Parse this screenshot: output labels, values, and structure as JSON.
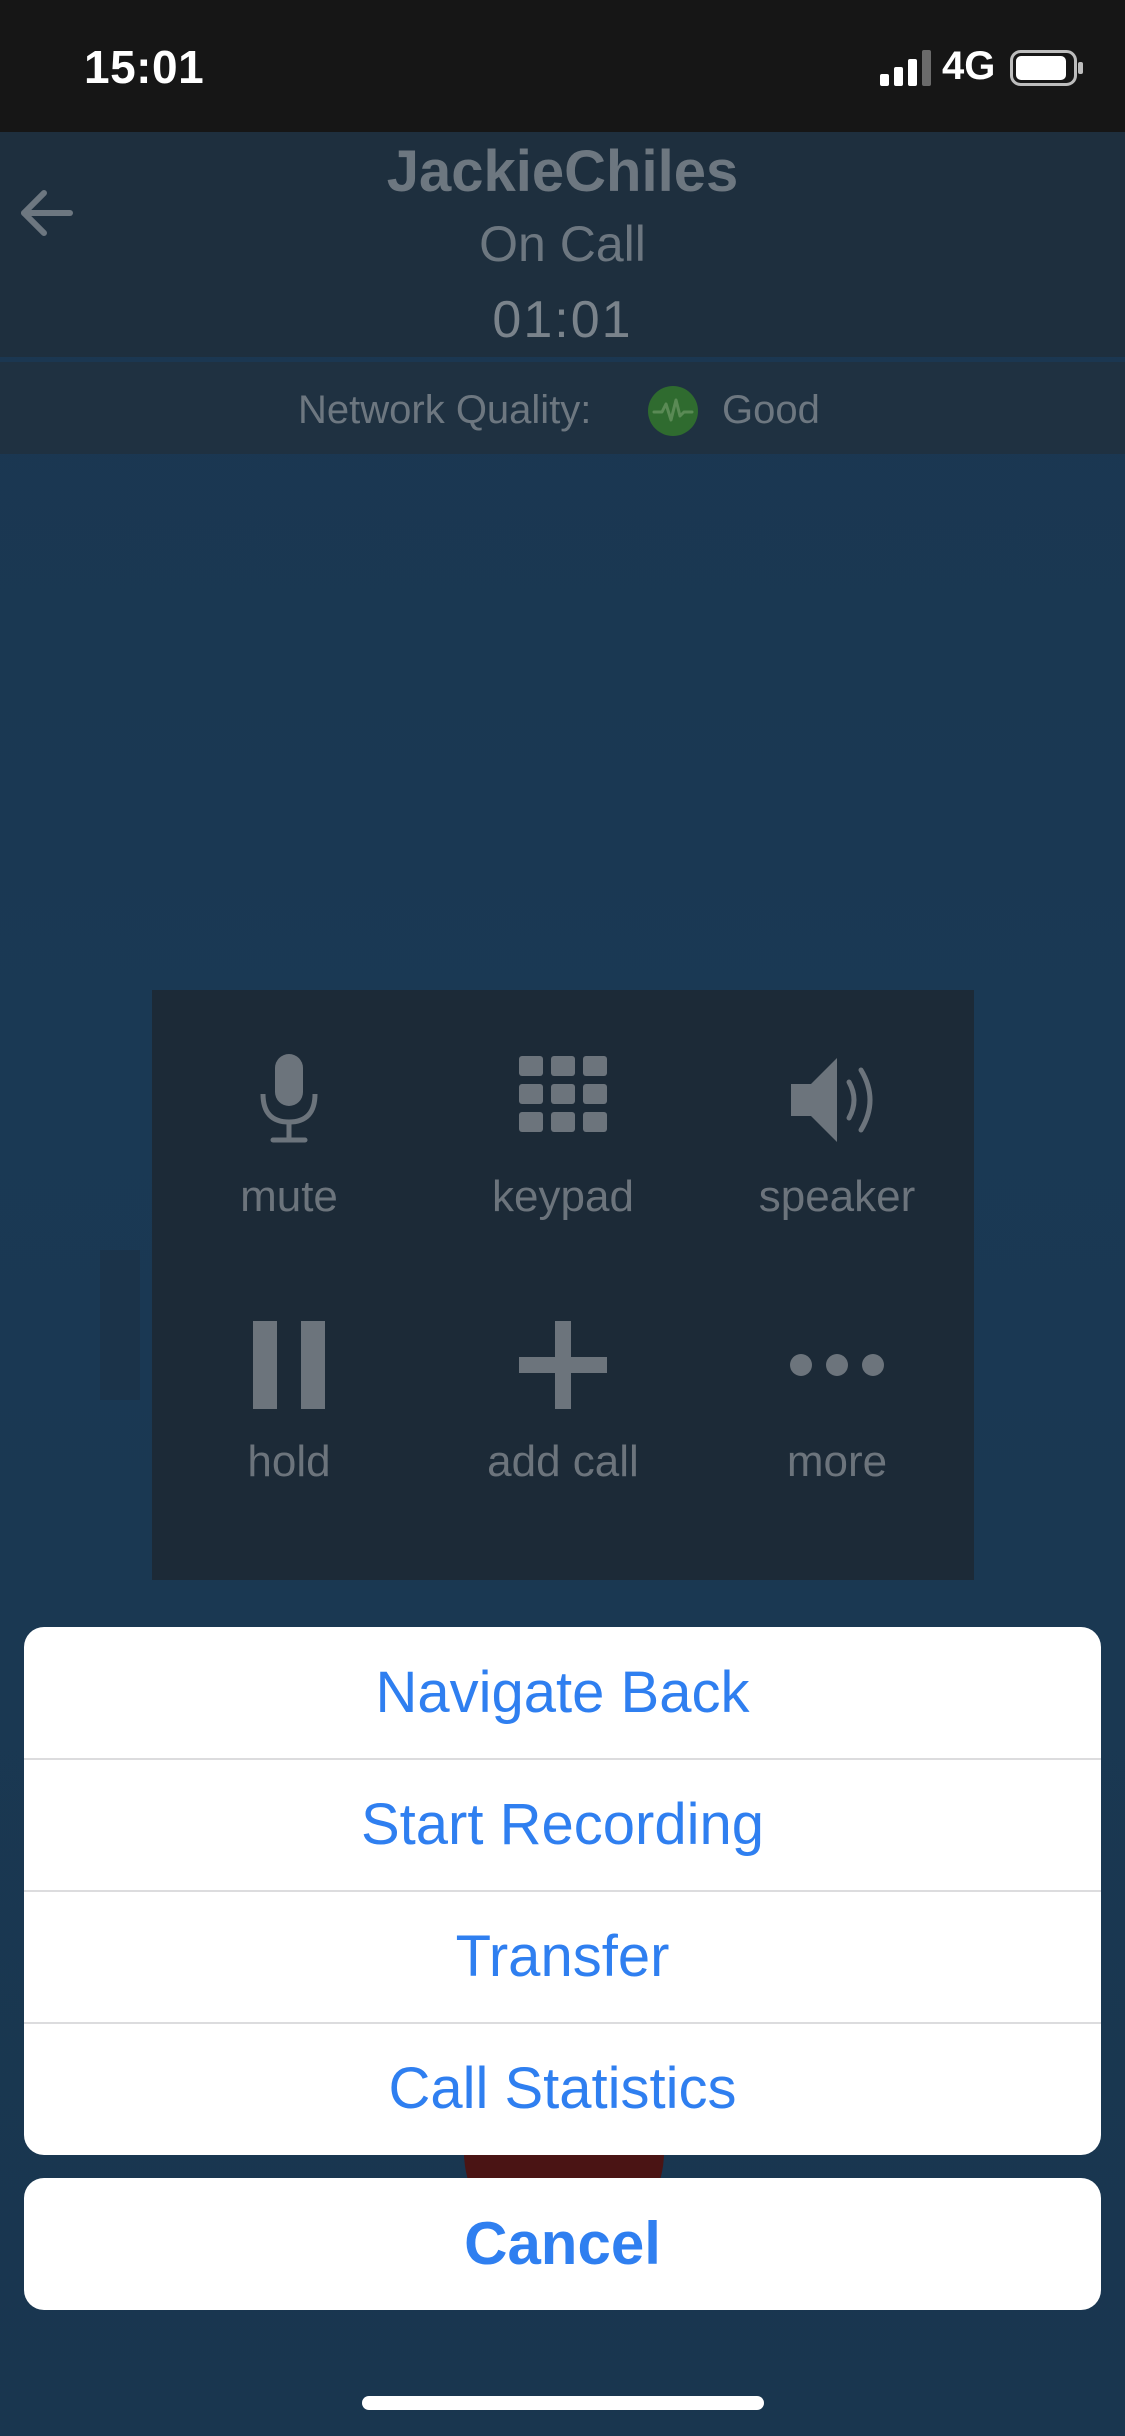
{
  "status_bar": {
    "time": "15:01",
    "network_type": "4G",
    "icons": [
      "signal-icon",
      "battery-icon"
    ]
  },
  "call": {
    "caller_name": "JackieChiles",
    "status": "On Call",
    "timer": "01:01",
    "back_icon": "arrow-left-icon"
  },
  "network": {
    "label": "Network Quality:",
    "value": "Good",
    "icon": "pulse-icon",
    "quality_color": "#3a8a3a"
  },
  "controls": [
    {
      "label": "mute",
      "icon": "microphone-icon"
    },
    {
      "label": "keypad",
      "icon": "keypad-icon"
    },
    {
      "label": "speaker",
      "icon": "speaker-icon"
    },
    {
      "label": "hold",
      "icon": "pause-icon"
    },
    {
      "label": "add call",
      "icon": "plus-icon"
    },
    {
      "label": "more",
      "icon": "more-icon"
    }
  ],
  "action_sheet": {
    "items": [
      "Navigate Back",
      "Start Recording",
      "Transfer",
      "Call Statistics"
    ],
    "cancel": "Cancel",
    "accent": "#2f7ff0"
  }
}
